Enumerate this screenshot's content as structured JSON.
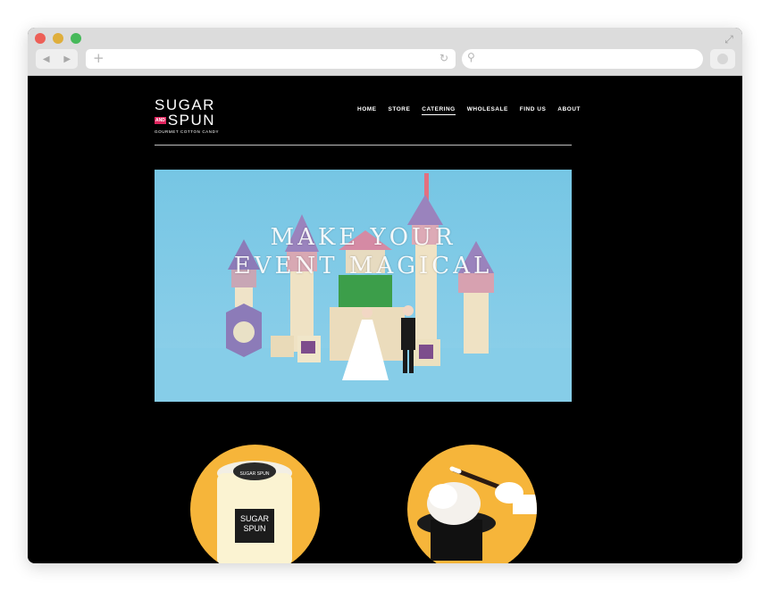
{
  "browser": {
    "url_text": "",
    "search_text": ""
  },
  "site": {
    "logo": {
      "line1": "SUGAR",
      "and": "AND",
      "line2": "SPUN",
      "tagline": "GOURMET COTTON CANDY"
    },
    "nav": [
      {
        "label": "HOME",
        "active": false
      },
      {
        "label": "STORE",
        "active": false
      },
      {
        "label": "CATERING",
        "active": true
      },
      {
        "label": "WHOLESALE",
        "active": false
      },
      {
        "label": "FIND US",
        "active": false
      },
      {
        "label": "ABOUT",
        "active": false
      }
    ],
    "hero": {
      "title_line1": "MAKE YOUR",
      "title_line2": "EVENT MAGICAL"
    },
    "product_jar": {
      "lid_text": "SUGAR SPUN",
      "label_line1": "SUGAR",
      "label_line2": "SPUN"
    }
  },
  "colors": {
    "accent_pink": "#e0245e",
    "hero_sky": "#7ccbe8",
    "circle_orange": "#f6b53a",
    "page_bg": "#000000"
  },
  "icons": [
    "close-dot",
    "minimize-dot",
    "zoom-dot",
    "back-icon",
    "forward-icon",
    "new-tab-icon",
    "reload-icon",
    "search-icon",
    "expand-icon"
  ]
}
